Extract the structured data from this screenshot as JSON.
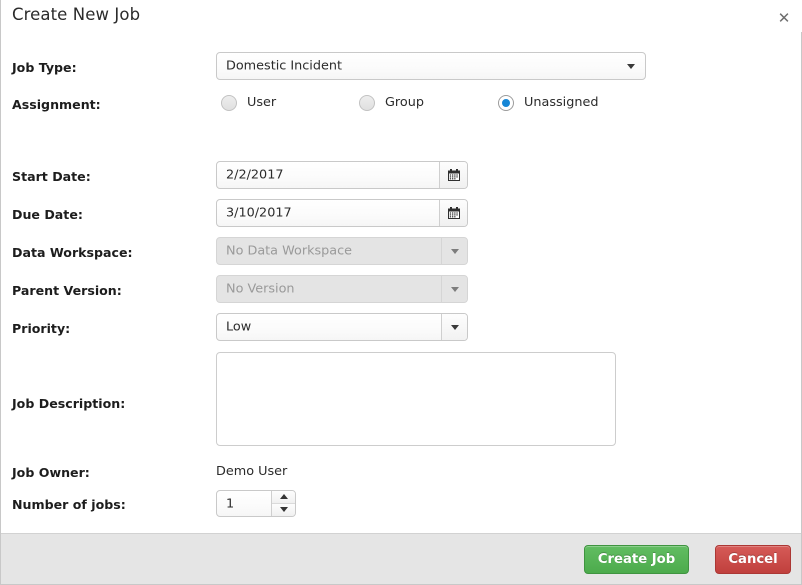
{
  "dialog": {
    "title": "Create New Job",
    "close_icon": "close-icon"
  },
  "fields": {
    "job_type": {
      "label": "Job Type:",
      "value": "Domestic Incident",
      "icon": "chevron-down-icon"
    },
    "assignment": {
      "label": "Assignment:",
      "options": [
        {
          "label": "User",
          "checked": false
        },
        {
          "label": "Group",
          "checked": false
        },
        {
          "label": "Unassigned",
          "checked": true
        }
      ]
    },
    "start_date": {
      "label": "Start Date:",
      "value": "2/2/2017",
      "icon": "calendar-icon"
    },
    "due_date": {
      "label": "Due Date:",
      "value": "3/10/2017",
      "icon": "calendar-icon"
    },
    "data_workspace": {
      "label": "Data Workspace:",
      "value": "No Data Workspace",
      "disabled": true,
      "icon": "chevron-down-icon"
    },
    "parent_version": {
      "label": "Parent Version:",
      "value": "No Version",
      "disabled": true,
      "icon": "chevron-down-icon"
    },
    "priority": {
      "label": "Priority:",
      "value": "Low",
      "icon": "chevron-down-icon"
    },
    "job_description": {
      "label": "Job Description:",
      "value": "",
      "placeholder": ""
    },
    "job_owner": {
      "label": "Job Owner:",
      "value": "Demo User"
    },
    "number_of_jobs": {
      "label": "Number of jobs:",
      "value": "1",
      "increment_icon": "triangle-up-icon",
      "decrement_icon": "triangle-down-icon"
    }
  },
  "footer": {
    "create_label": "Create Job",
    "cancel_label": "Cancel"
  },
  "colors": {
    "accent_radio": "#1686d6",
    "create_button": "#4cab4c",
    "cancel_button": "#c0403d",
    "footer_background": "#e5e5e5"
  }
}
